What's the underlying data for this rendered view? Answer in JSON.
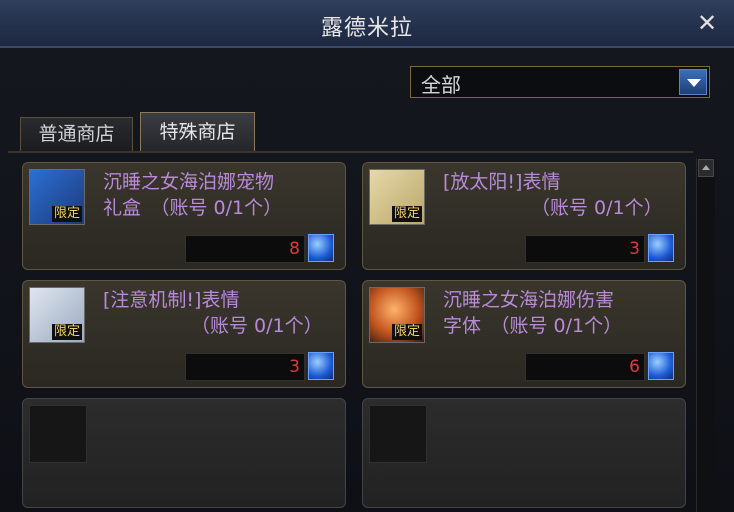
{
  "window": {
    "title": "露德米拉"
  },
  "filter": {
    "selected": "全部"
  },
  "tabs": [
    {
      "label": "普通商店"
    },
    {
      "label": "特殊商店"
    }
  ],
  "items": [
    {
      "name_line1": "沉睡之女海泊娜宠物",
      "name_line2": "礼盒　（账号 0/1个）",
      "tag": "限定",
      "price": "8",
      "icon": "pet-box-icon"
    },
    {
      "name_line1": "[放太阳!]表情",
      "name_line2": "（账号 0/1个）",
      "tag": "限定",
      "price": "3",
      "icon": "emote-icon"
    },
    {
      "name_line1": "[注意机制!]表情",
      "name_line2": "（账号 0/1个）",
      "tag": "限定",
      "price": "3",
      "icon": "emote-icon"
    },
    {
      "name_line1": "沉睡之女海泊娜伤害",
      "name_line2": "字体　（账号 0/1个）",
      "tag": "限定",
      "price": "6",
      "icon": "damage-font-icon"
    }
  ],
  "colors": {
    "item_name": "#b88ad8",
    "price": "#e23a3a",
    "tag": "#f2d36a"
  }
}
